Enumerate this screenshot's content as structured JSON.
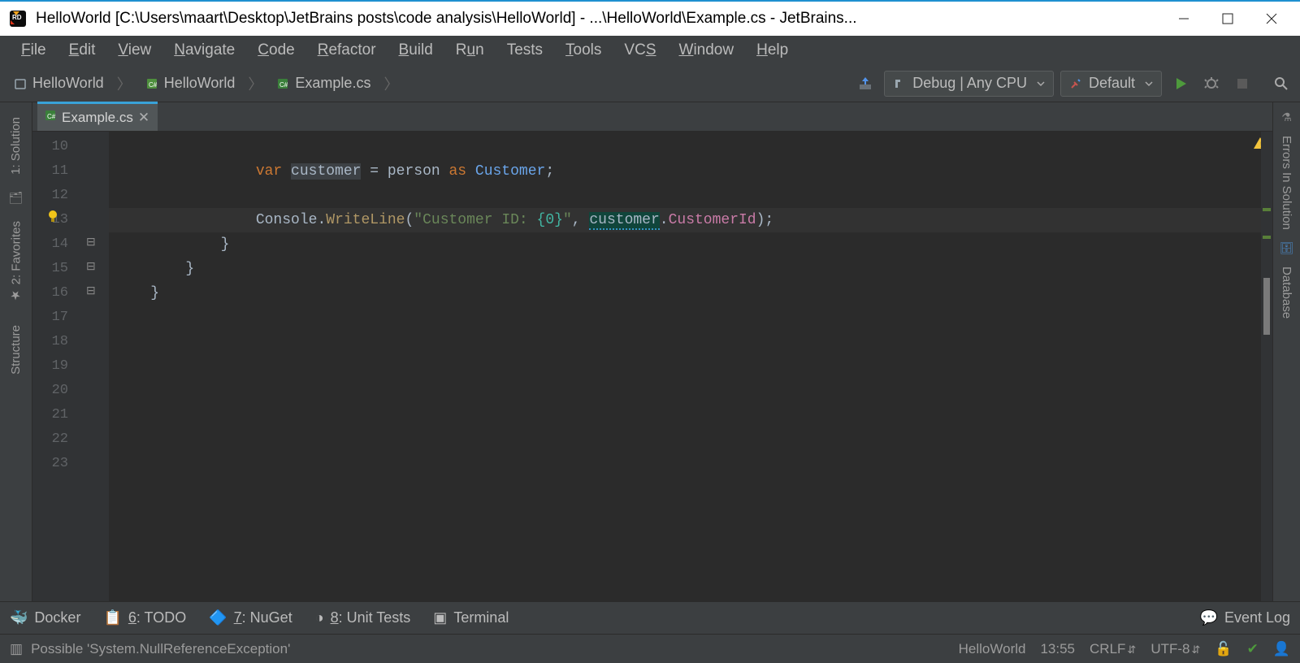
{
  "title": "HelloWorld [C:\\Users\\maart\\Desktop\\JetBrains posts\\code analysis\\HelloWorld] - ...\\HelloWorld\\Example.cs - JetBrains...",
  "menu": [
    "File",
    "Edit",
    "View",
    "Navigate",
    "Code",
    "Refactor",
    "Build",
    "Run",
    "Tests",
    "Tools",
    "VCS",
    "Window",
    "Help"
  ],
  "menu_mnemonic_index": [
    0,
    0,
    0,
    0,
    0,
    0,
    0,
    1,
    -1,
    0,
    2,
    0,
    0
  ],
  "breadcrumb": {
    "item1": "HelloWorld",
    "item2": "HelloWorld",
    "item3": "Example.cs"
  },
  "configs": {
    "run": "Debug | Any CPU",
    "scheme": "Default"
  },
  "tab": {
    "name": "Example.cs"
  },
  "line_numbers": [
    10,
    11,
    12,
    13,
    14,
    15,
    16,
    17,
    18,
    19,
    20,
    21,
    22,
    23
  ],
  "code": {
    "l11": {
      "kw": "var",
      "name": "customer",
      "eq": " = ",
      "rhs": "person",
      "as": " as ",
      "type": "Customer",
      "end": ";"
    },
    "l13": {
      "obj": "Console",
      "dot": ".",
      "m": "WriteLine",
      "open": "(",
      "s1": "\"Customer ID: ",
      "fmt": "{0}",
      "s2": "\"",
      "comma": ", ",
      "warn": "customer",
      "dot2": ".",
      "prop": "CustomerId",
      "close": ");"
    },
    "l14": "            }",
    "l15": "        }",
    "l16": "    }"
  },
  "left_tool_windows": {
    "solution": "1: Solution",
    "favorites": "2: Favorites",
    "structure": "Structure"
  },
  "right_tool_windows": {
    "errors": "Errors In Solution",
    "database": "Database"
  },
  "bottom_tools": {
    "docker": "Docker",
    "todo": "6: TODO",
    "nuget": "7: NuGet",
    "unit": "8: Unit Tests",
    "terminal": "Terminal",
    "eventlog": "Event Log"
  },
  "status": {
    "msg": "Possible 'System.NullReferenceException'",
    "project": "HelloWorld",
    "time": "13:55",
    "crlf": "CRLF",
    "enc": "UTF-8"
  }
}
